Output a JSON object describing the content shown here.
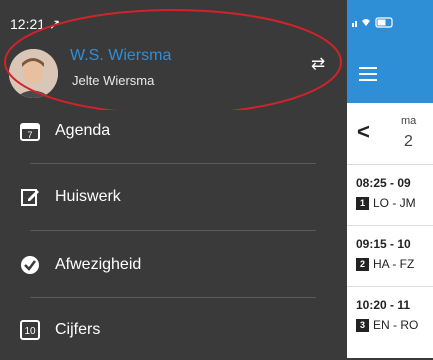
{
  "status": {
    "time": "12:21 ↗"
  },
  "profile": {
    "name": "W.S. Wiersma",
    "sub": "Jelte Wiersma"
  },
  "menu": [
    {
      "label": "Agenda",
      "icon": "calendar-icon",
      "badge": "7"
    },
    {
      "label": "Huiswerk",
      "icon": "edit-icon"
    },
    {
      "label": "Afwezigheid",
      "icon": "check-circle-icon"
    },
    {
      "label": "Cijfers",
      "icon": "grade-icon",
      "badge": "10"
    }
  ],
  "schedule": {
    "day_name": "ma",
    "day_num": "2",
    "lessons": [
      {
        "time": "08:25 - 09",
        "num": "1",
        "code": "LO - JM"
      },
      {
        "time": "09:15 - 10",
        "num": "2",
        "code": "HA - FZ"
      },
      {
        "time": "10:20 - 11",
        "num": "3",
        "code": "EN - RO"
      }
    ]
  },
  "colors": {
    "accent": "#2f8fd6",
    "drawer": "#3a3a3a",
    "highlight": "#d0232a"
  }
}
